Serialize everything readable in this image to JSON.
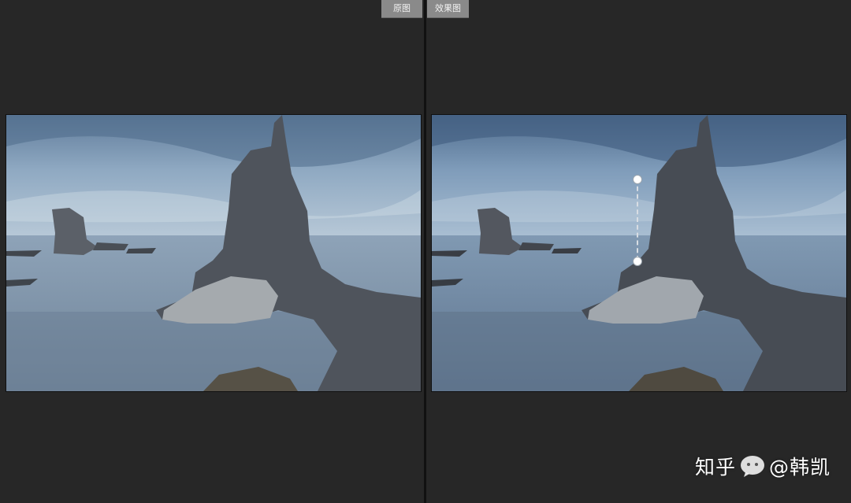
{
  "tabs": {
    "before_label": "原图",
    "after_label": "效果图"
  },
  "watermark": {
    "platform": "知乎",
    "author": "@韩凯"
  },
  "colors": {
    "background": "#272727",
    "divider": "#111111",
    "tab_bg": "#8a8a8a",
    "sky_top": "#6e89a6",
    "sea": "#7f96ad"
  },
  "icons": {
    "watermark": "chat-bubble-icon"
  }
}
